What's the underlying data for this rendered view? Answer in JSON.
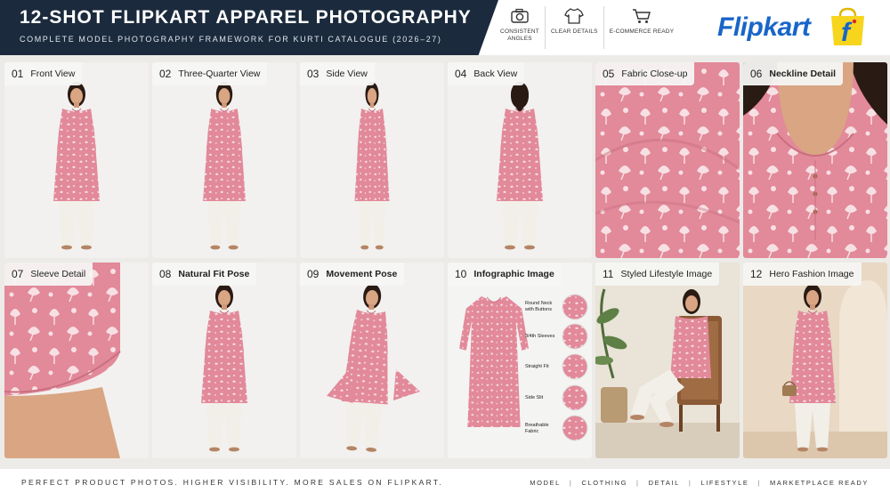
{
  "header": {
    "title": "12-SHOT FLIPKART APPAREL PHOTOGRAPHY",
    "subtitle": "COMPLETE MODEL PHOTOGRAPHY FRAMEWORK FOR KURTI CATALOGUE (2026–27)",
    "features": [
      {
        "icon": "camera-icon",
        "label": "CONSISTENT ANGLES"
      },
      {
        "icon": "tshirt-icon",
        "label": "CLEAR DETAILS"
      },
      {
        "icon": "cart-icon",
        "label": "E-COMMERCE READY"
      }
    ],
    "brand": "Flipkart",
    "brand_color": "#1865c9",
    "bag_color": "#f7d51d"
  },
  "shots": [
    {
      "num": "01",
      "title": "Front View",
      "bold": false
    },
    {
      "num": "02",
      "title": "Three-Quarter View",
      "bold": false
    },
    {
      "num": "03",
      "title": "Side View",
      "bold": false
    },
    {
      "num": "04",
      "title": "Back View",
      "bold": false
    },
    {
      "num": "05",
      "title": "Fabric Close-up",
      "bold": false
    },
    {
      "num": "06",
      "title": "Neckline Detail",
      "bold": true
    },
    {
      "num": "07",
      "title": "Sleeve Detail",
      "bold": false
    },
    {
      "num": "08",
      "title": "Natural Fit Pose",
      "bold": true
    },
    {
      "num": "09",
      "title": "Movement Pose",
      "bold": true
    },
    {
      "num": "10",
      "title": "Infographic Image",
      "bold": true
    },
    {
      "num": "11",
      "title": "Styled Lifestyle Image",
      "bold": false
    },
    {
      "num": "12",
      "title": "Hero Fashion Image",
      "bold": false
    }
  ],
  "infographic_labels": [
    "Round Neck with Buttons",
    "3/4th Sleeves",
    "Straight Fit",
    "Side Slit",
    "Breathable Fabric"
  ],
  "colors": {
    "kurti_pink": "#e2899a",
    "print_cream": "#f5dde0",
    "pant_white": "#f2efe8",
    "header_navy": "#1b2a3c"
  },
  "footer": {
    "tagline": "PERFECT PRODUCT PHOTOS. HIGHER VISIBILITY. MORE SALES ON FLIPKART.",
    "links": [
      "MODEL",
      "CLOTHING",
      "DETAIL",
      "LIFESTYLE",
      "MARKETPLACE READY"
    ]
  }
}
